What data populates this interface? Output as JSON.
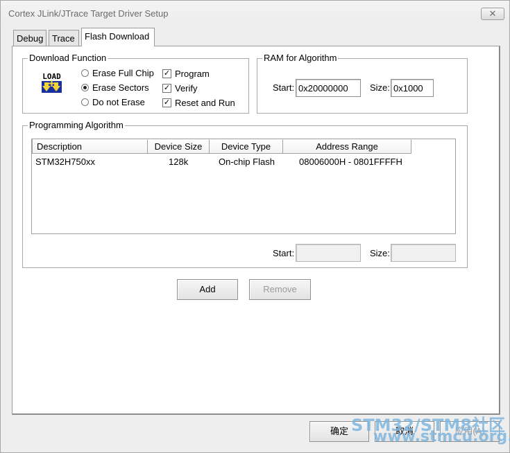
{
  "window": {
    "title": "Cortex JLink/JTrace Target Driver Setup",
    "close_glyph": "✕"
  },
  "tabs": [
    {
      "label": "Debug"
    },
    {
      "label": "Trace"
    },
    {
      "label": "Flash Download",
      "active": true
    }
  ],
  "download_function": {
    "title": "Download Function",
    "icon_text": "LOAD",
    "radios": [
      {
        "label": "Erase Full Chip",
        "checked": false
      },
      {
        "label": "Erase Sectors",
        "checked": true
      },
      {
        "label": "Do not Erase",
        "checked": false
      }
    ],
    "checks": [
      {
        "label": "Program",
        "checked": true
      },
      {
        "label": "Verify",
        "checked": true
      },
      {
        "label": "Reset and Run",
        "checked": true
      }
    ],
    "check_glyph": "✓"
  },
  "ram": {
    "title": "RAM for Algorithm",
    "start_label": "Start:",
    "start_value": "0x20000000",
    "size_label": "Size:",
    "size_value": "0x1000"
  },
  "programming_algorithm": {
    "title": "Programming Algorithm",
    "columns": [
      "Description",
      "Device Size",
      "Device Type",
      "Address Range"
    ],
    "rows": [
      [
        "STM32H750xx",
        "128k",
        "On-chip Flash",
        "08006000H - 0801FFFFH"
      ]
    ],
    "start_label": "Start:",
    "start_value": "",
    "size_label": "Size:",
    "size_value": ""
  },
  "buttons": {
    "add": "Add",
    "remove": "Remove",
    "ok": "确定",
    "cancel": "取消",
    "apply": "应用(A)"
  },
  "watermark": {
    "line1": "STM32/STM8社区",
    "line2": "www.stmcu.org.cn"
  }
}
